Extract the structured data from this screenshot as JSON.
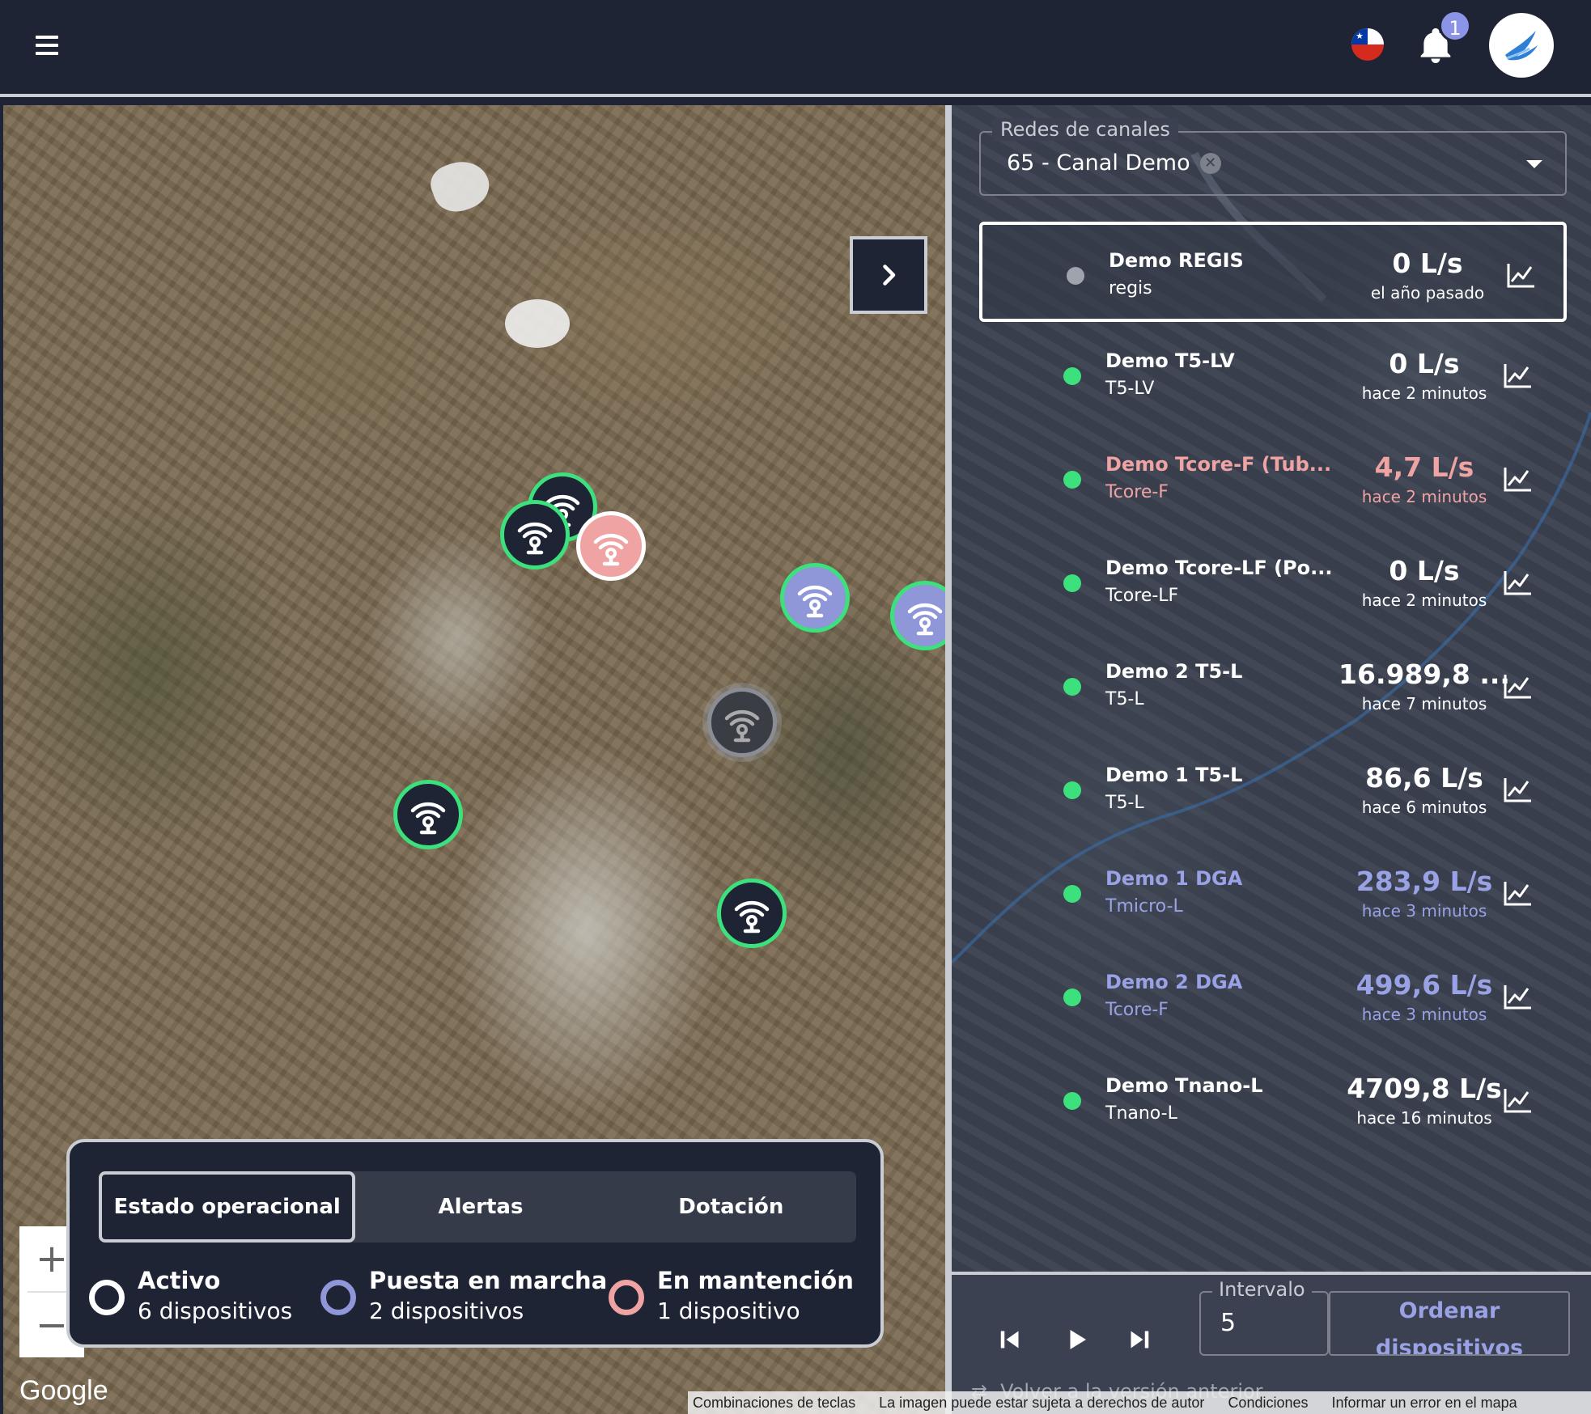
{
  "header": {
    "menu_icon": "hamburger-icon",
    "flag_icon": "chile-flag-icon",
    "notifications_icon": "bell-icon",
    "notification_count": "1",
    "avatar_icon": "bird-logo-icon"
  },
  "map": {
    "toggle_icon": "chevron-right-icon",
    "zoom_in_label": "+",
    "zoom_out_label": "−",
    "google_label": "Google",
    "footer": {
      "shortcuts": "Combinaciones de teclas",
      "image_notice": "La imagen puede estar sujeta a derechos de autor",
      "terms": "Condiciones",
      "report": "Informar un error en el mapa"
    },
    "markers": [
      {
        "status": "active",
        "icon": "antenna-icon"
      },
      {
        "status": "active",
        "icon": "antenna-icon"
      },
      {
        "status": "maintenance",
        "icon": "antenna-icon"
      },
      {
        "status": "startup",
        "icon": "antenna-icon"
      },
      {
        "status": "startup",
        "icon": "antenna-icon"
      },
      {
        "status": "inactive",
        "icon": "antenna-icon"
      },
      {
        "status": "active",
        "icon": "antenna-icon"
      },
      {
        "status": "active",
        "icon": "antenna-icon"
      }
    ]
  },
  "legend": {
    "tabs": [
      {
        "label": "Estado operacional",
        "active": true
      },
      {
        "label": "Alertas",
        "active": false
      },
      {
        "label": "Dotación",
        "active": false
      }
    ],
    "items": [
      {
        "title": "Activo",
        "subtitle": "6 dispositivos",
        "color": "#ffffff"
      },
      {
        "title": "Puesta en marcha",
        "subtitle": "2 dispositivos",
        "color": "#8f97d8"
      },
      {
        "title": "En mantención",
        "subtitle": "1 dispositivo",
        "color": "#f0a3a3"
      }
    ]
  },
  "panel": {
    "network_select": {
      "label": "Redes de canales",
      "value": "65 - Canal Demo",
      "clear_icon": "close-circle-icon",
      "dropdown_icon": "caret-down-icon"
    },
    "devices": [
      {
        "name": "Demo REGIS",
        "code": "regis",
        "value": "0 L/s",
        "time": "el año pasado",
        "status_color": "#9ea3ad",
        "text_color": "white"
      },
      {
        "name": "Demo T5-LV",
        "code": "T5-LV",
        "value": "0 L/s",
        "time": "hace 2 minutos",
        "status_color": "#3ce07c",
        "text_color": "white"
      },
      {
        "name": "Demo Tcore-F (Tub...",
        "code": "Tcore-F",
        "value": "4,7 L/s",
        "time": "hace 2 minutos",
        "status_color": "#3ce07c",
        "text_color": "red"
      },
      {
        "name": "Demo Tcore-LF (Po...",
        "code": "Tcore-LF",
        "value": "0 L/s",
        "time": "hace 2 minutos",
        "status_color": "#3ce07c",
        "text_color": "white"
      },
      {
        "name": "Demo 2 T5-L",
        "code": "T5-L",
        "value": "16.989,8 ...",
        "time": "hace 7 minutos",
        "status_color": "#3ce07c",
        "text_color": "white"
      },
      {
        "name": "Demo 1 T5-L",
        "code": "T5-L",
        "value": "86,6 L/s",
        "time": "hace 6 minutos",
        "status_color": "#3ce07c",
        "text_color": "white"
      },
      {
        "name": "Demo 1 DGA",
        "code": "Tmicro-L",
        "value": "283,9 L/s",
        "time": "hace 3 minutos",
        "status_color": "#3ce07c",
        "text_color": "purple"
      },
      {
        "name": "Demo 2 DGA",
        "code": "Tcore-F",
        "value": "499,6 L/s",
        "time": "hace 3 minutos",
        "status_color": "#3ce07c",
        "text_color": "purple"
      },
      {
        "name": "Demo Tnano-L",
        "code": "Tnano-L",
        "value": "4709,8 L/s",
        "time": "hace 16 minutos",
        "status_color": "#3ce07c",
        "text_color": "white"
      }
    ],
    "chart_icon": "line-chart-icon",
    "controls": {
      "prev_icon": "skip-previous-icon",
      "play_icon": "play-icon",
      "next_icon": "skip-next-icon",
      "interval_label": "Intervalo",
      "interval_value": "5",
      "order_line1": "Ordenar",
      "order_line2": "dispositivos",
      "back_icon": "swap-arrows-icon",
      "back_label": "Volver a la versión anterior"
    }
  }
}
